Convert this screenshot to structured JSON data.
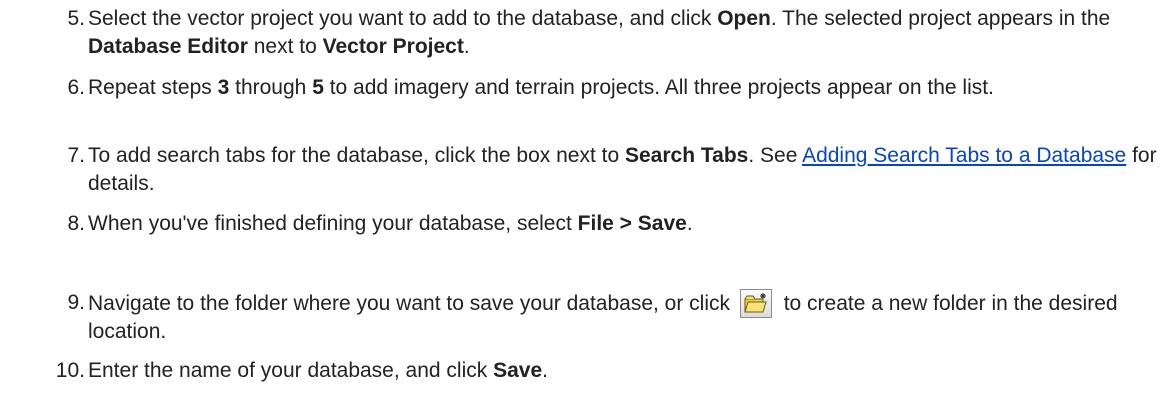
{
  "steps": [
    {
      "num": "5.",
      "t1": "Select the vector project you want to add to the database, and click ",
      "b1": "Open",
      "t2": ". The selected project appears in the ",
      "b2": "Database Editor",
      "t3": " next to ",
      "b3": "Vector Project",
      "t4": "."
    },
    {
      "num": "6.",
      "t1": "Repeat steps ",
      "b1": "3",
      "t2": " through ",
      "b2": "5",
      "t3": " to add imagery and terrain projects. All three projects appear on the list."
    },
    {
      "num": "7.",
      "t1": "To add search tabs for the database, click the box next to ",
      "b1": "Search Tabs",
      "t2": ". See ",
      "link": "Adding Search Tabs to a Database",
      "t3": " for details."
    },
    {
      "num": "8.",
      "t1": "When you've finished defining your database, select ",
      "b1": "File > Save",
      "t2": "."
    },
    {
      "num": "9.",
      "t1": "Navigate to the folder where you want to save your database, or click ",
      "icon": "new-folder-icon",
      "t2": " to create a new folder in the desired location."
    },
    {
      "num": "10.",
      "t1": "Enter the name of your database, and click ",
      "b1": "Save",
      "t2": "."
    }
  ]
}
